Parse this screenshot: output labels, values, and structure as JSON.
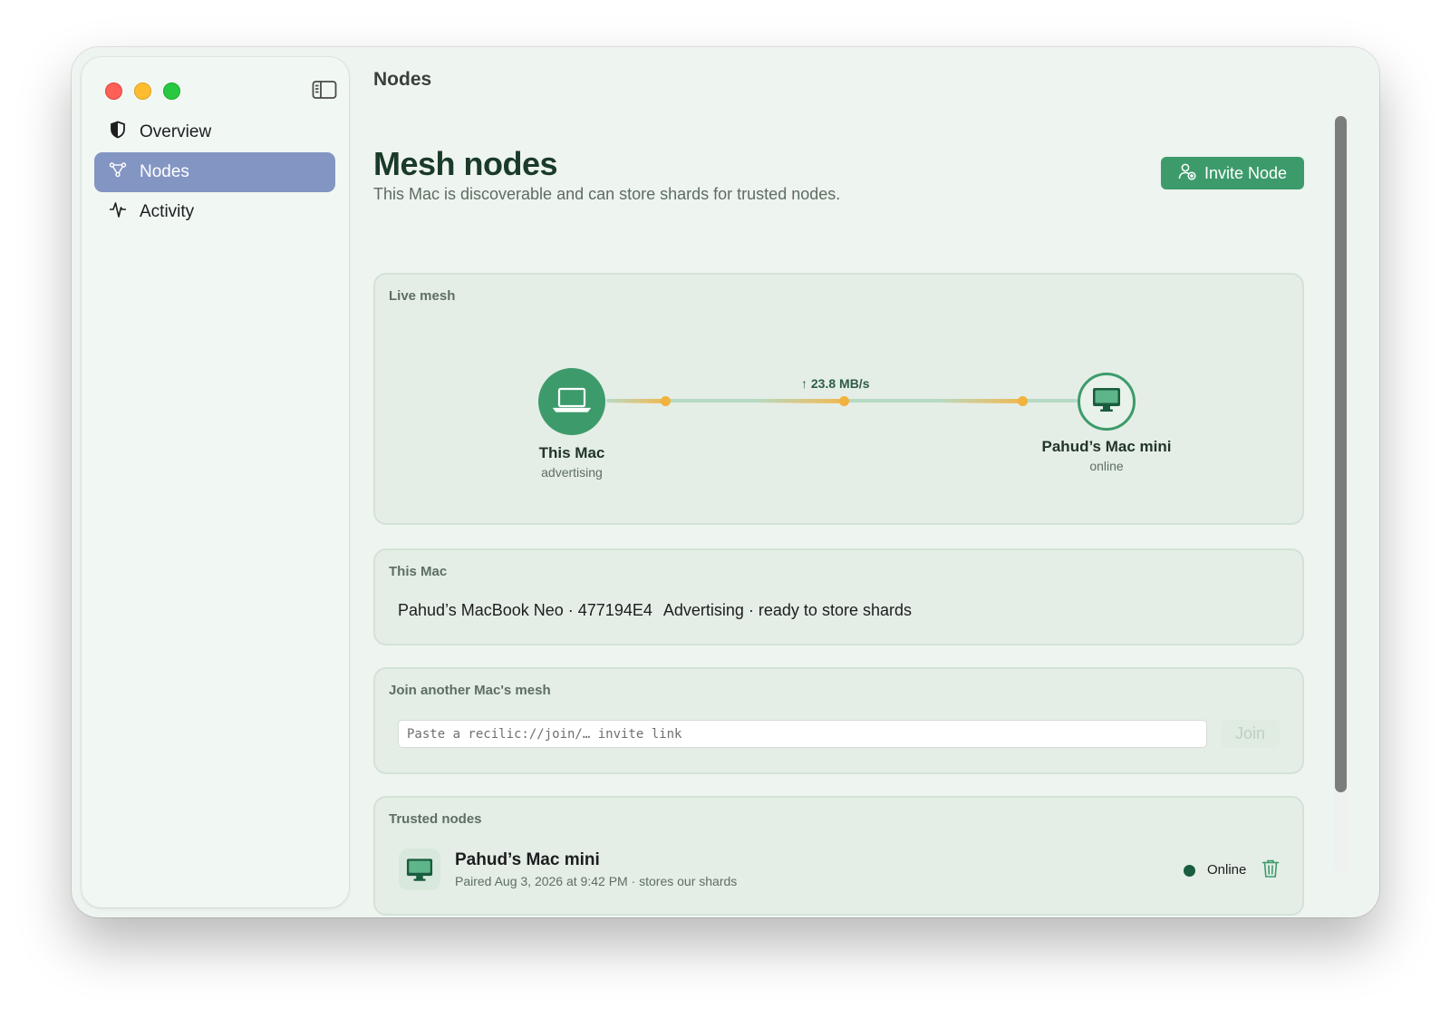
{
  "window": {
    "toolbar_title": "Nodes"
  },
  "sidebar": {
    "items": [
      {
        "label": "Overview",
        "icon": "shield-icon"
      },
      {
        "label": "Nodes",
        "icon": "network-nodes-icon",
        "selected": true
      },
      {
        "label": "Activity",
        "icon": "waveform-icon"
      }
    ]
  },
  "header": {
    "title": "Mesh nodes",
    "subtitle": "This Mac is discoverable and can store shards for trusted nodes.",
    "invite_button": "Invite Node"
  },
  "live_mesh": {
    "label": "Live mesh",
    "transfer_rate": "↑ 23.8 MB/s",
    "local_node": {
      "name": "This Mac",
      "status": "advertising",
      "icon": "laptop-icon"
    },
    "remote_node": {
      "name": "Pahud’s Mac mini",
      "status": "online",
      "icon": "desktop-icon"
    }
  },
  "this_mac": {
    "label": "This Mac",
    "device": "Pahud’s MacBook Neo · 477194E4",
    "status": "Advertising · ready to store shards"
  },
  "join": {
    "label": "Join another Mac's mesh",
    "placeholder": "Paste a recilic://join/… invite link",
    "button": "Join"
  },
  "trusted": {
    "label": "Trusted nodes",
    "nodes": [
      {
        "name": "Pahud’s Mac mini",
        "detail": "Paired Aug 3, 2026 at 9:42 PM · stores our shards",
        "status": "Online",
        "icon": "desktop-icon"
      }
    ]
  },
  "colors": {
    "accent": "#3d9b6b",
    "sidebar_selection": "#8395c2",
    "transfer_glow": "#f2b23e",
    "online": "#1a5c3e"
  }
}
